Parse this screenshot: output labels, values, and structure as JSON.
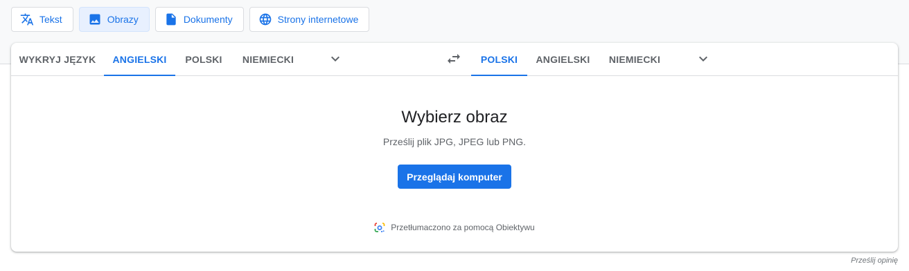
{
  "modes": [
    {
      "label": "Tekst",
      "icon": "translate-icon",
      "active": false
    },
    {
      "label": "Obrazy",
      "icon": "image-icon",
      "active": true
    },
    {
      "label": "Dokumenty",
      "icon": "document-icon",
      "active": false
    },
    {
      "label": "Strony internetowe",
      "icon": "globe-icon",
      "active": false
    }
  ],
  "source_langs": [
    {
      "label": "WYKRYJ JĘZYK",
      "active": false
    },
    {
      "label": "ANGIELSKI",
      "active": true
    },
    {
      "label": "POLSKI",
      "active": false
    },
    {
      "label": "NIEMIECKI",
      "active": false
    }
  ],
  "target_langs": [
    {
      "label": "POLSKI",
      "active": true
    },
    {
      "label": "ANGIELSKI",
      "active": false
    },
    {
      "label": "NIEMIECKI",
      "active": false
    }
  ],
  "icons": {
    "more_source": "chevron-down-icon",
    "swap": "swap-languages-icon",
    "more_target": "chevron-down-icon",
    "lens": "google-lens-icon"
  },
  "main": {
    "title": "Wybierz obraz",
    "subtitle": "Prześlij plik JPG, JPEG lub PNG.",
    "browse_label": "Przeglądaj komputer",
    "lens_note": "Przetłumaczono za pomocą Obiektywu"
  },
  "footer": {
    "feedback": "Prześlij opinię"
  },
  "colors": {
    "accent": "#1a73e8",
    "active_bg": "#e8f0fe",
    "text": "#5f6368"
  }
}
